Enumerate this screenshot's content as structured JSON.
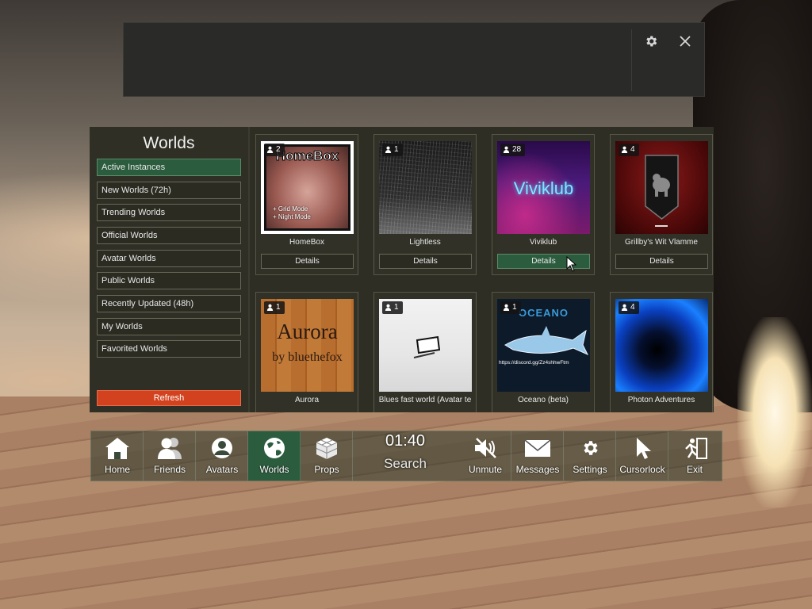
{
  "sidebar": {
    "title": "Worlds",
    "items": [
      {
        "label": "Active Instances",
        "active": true
      },
      {
        "label": "New Worlds (72h)"
      },
      {
        "label": "Trending Worlds"
      },
      {
        "label": "Official Worlds"
      },
      {
        "label": "Avatar Worlds"
      },
      {
        "label": "Public Worlds"
      },
      {
        "label": "Recently Updated (48h)"
      },
      {
        "label": "My Worlds"
      },
      {
        "label": "Favorited Worlds"
      }
    ],
    "refresh_label": "Refresh"
  },
  "worlds": [
    {
      "name": "HomeBox",
      "players": "2",
      "details_label": "Details",
      "thumb_text": "HomeBox",
      "thumb_lines": [
        "+ Grid Mode",
        "+ Night Mode"
      ]
    },
    {
      "name": "Lightless",
      "players": "1",
      "details_label": "Details"
    },
    {
      "name": "Viviklub",
      "players": "28",
      "details_label": "Details",
      "thumb_text": "Viviklub"
    },
    {
      "name": "Grillby's Wit Vlamme",
      "players": "4",
      "details_label": "Details"
    },
    {
      "name": "Aurora",
      "players": "1",
      "thumb_text": "Aurora",
      "thumb_sub": "by bluethefox"
    },
    {
      "name": "Blues fast world (Avatar te",
      "players": "1"
    },
    {
      "name": "Oceano (beta)",
      "players": "1",
      "thumb_text": "OCEANO",
      "thumb_sub": "https://discord.gg/Zz4shhwFtm"
    },
    {
      "name": "Photon Adventures",
      "players": "4"
    }
  ],
  "dock": {
    "buttons": [
      {
        "label": "Home",
        "icon": "home-icon"
      },
      {
        "label": "Friends",
        "icon": "friends-icon"
      },
      {
        "label": "Avatars",
        "icon": "avatar-icon"
      },
      {
        "label": "Worlds",
        "icon": "globe-icon",
        "active": true
      },
      {
        "label": "Props",
        "icon": "cube-icon"
      },
      {
        "label": "Unmute",
        "icon": "mute-icon"
      },
      {
        "label": "Messages",
        "icon": "envelope-icon"
      },
      {
        "label": "Settings",
        "icon": "gear-icon"
      },
      {
        "label": "Cursorlock",
        "icon": "cursor-icon"
      },
      {
        "label": "Exit",
        "icon": "exit-icon"
      }
    ],
    "clock": "01:40",
    "search_label": "Search"
  },
  "top_panel": {
    "settings_icon": "gear-icon",
    "close_icon": "close-icon"
  }
}
